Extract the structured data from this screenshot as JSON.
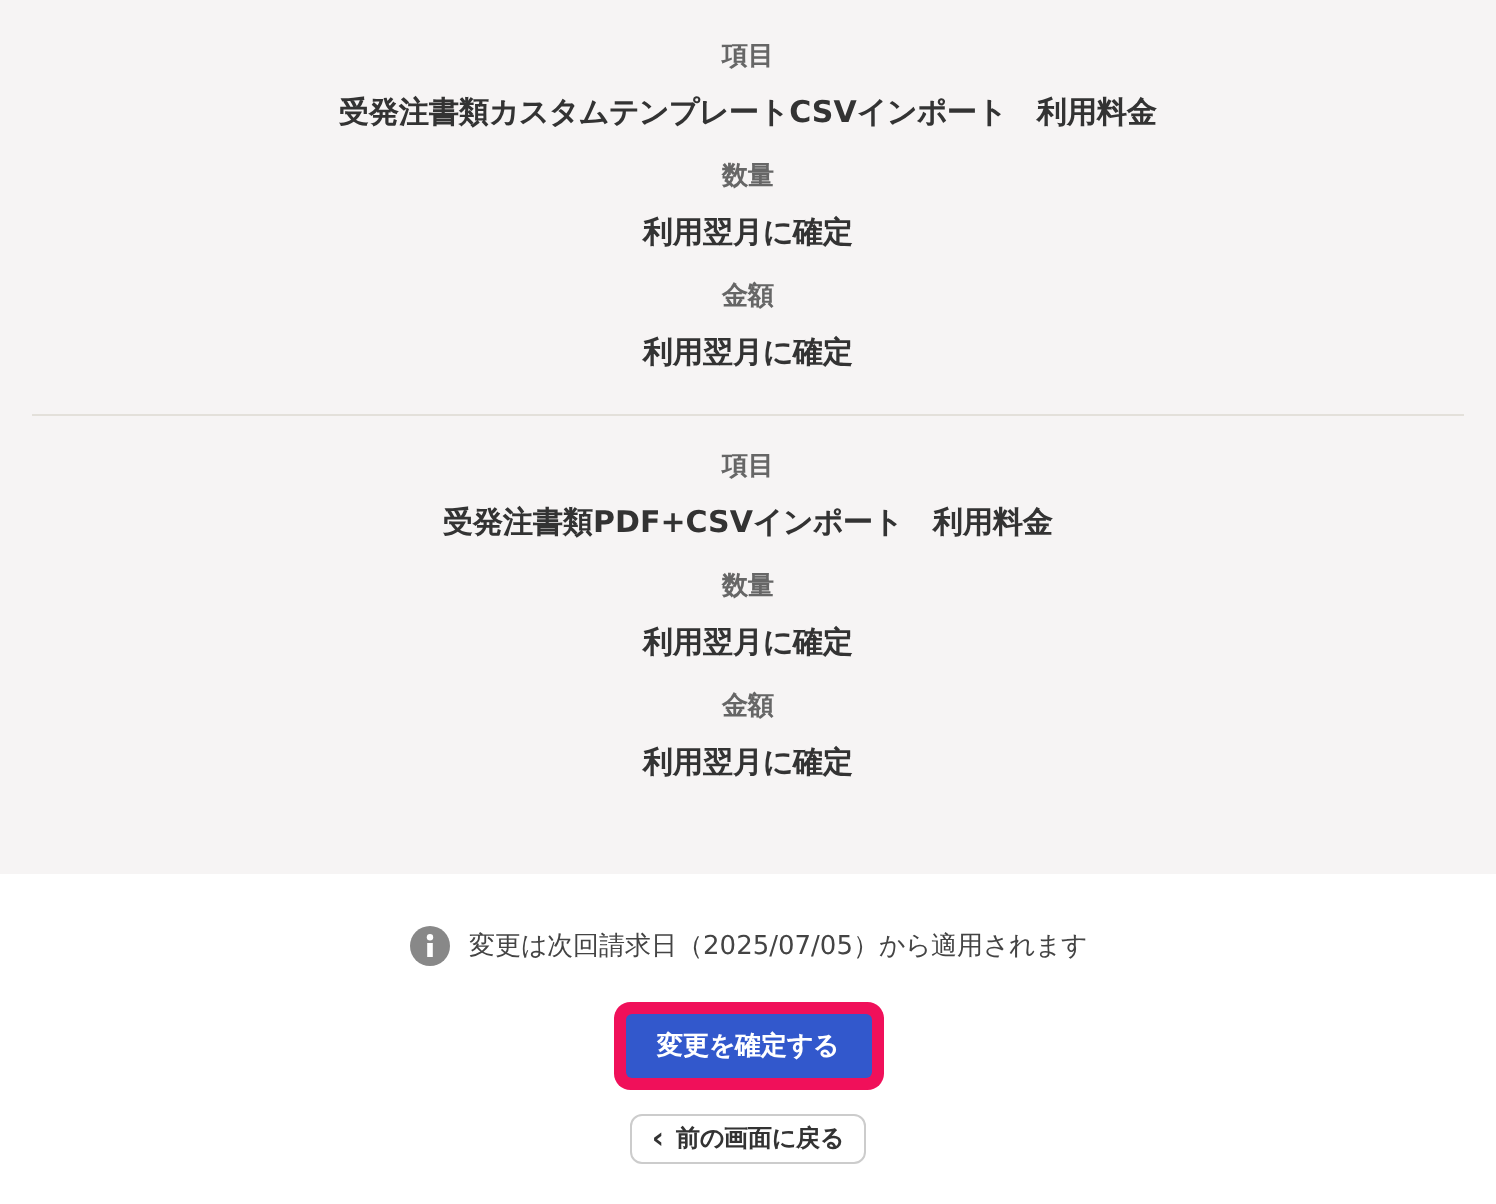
{
  "items": [
    {
      "fields": [
        {
          "label": "項目",
          "value": "受発注書類カスタムテンプレートCSVインポート　利用料金"
        },
        {
          "label": "数量",
          "value": "利用翌月に確定"
        },
        {
          "label": "金額",
          "value": "利用翌月に確定"
        }
      ]
    },
    {
      "fields": [
        {
          "label": "項目",
          "value": "受発注書類PDF+CSVインポート　利用料金"
        },
        {
          "label": "数量",
          "value": "利用翌月に確定"
        },
        {
          "label": "金額",
          "value": "利用翌月に確定"
        }
      ]
    }
  ],
  "notice": "変更は次回請求日（2025/07/05）から適用されます",
  "confirm_button": "変更を確定する",
  "back_button": {
    "icon": "‹",
    "label": "前の画面に戻る"
  }
}
